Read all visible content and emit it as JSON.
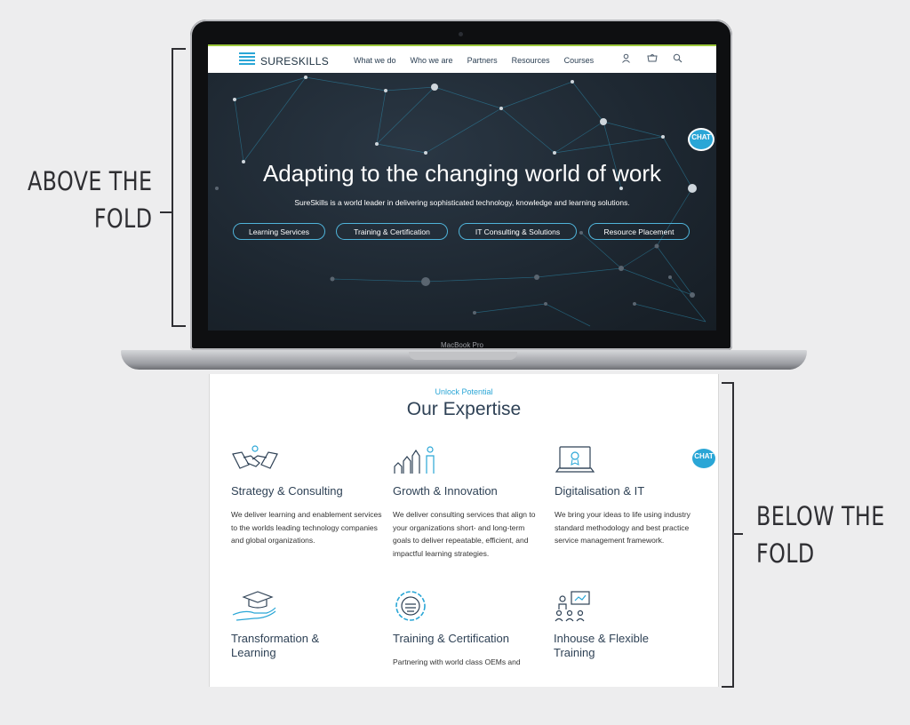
{
  "annotations": {
    "above": [
      "ABOVE THE",
      "FOLD"
    ],
    "below": [
      "BELOW THE",
      "FOLD"
    ]
  },
  "device": {
    "model": "MacBook Pro"
  },
  "nav": {
    "logo": "SURESKILLS",
    "links": [
      "What we do",
      "Who we are",
      "Partners",
      "Resources",
      "Courses"
    ],
    "icons": [
      "user-icon",
      "cart-icon",
      "search-icon"
    ]
  },
  "hero": {
    "title": "Adapting to the changing world of work",
    "subtitle": "SureSkills is a world leader in delivering sophisticated technology, knowledge and learning solutions.",
    "buttons": [
      "Learning Services",
      "Training & Certification",
      "IT Consulting & Solutions",
      "Resource Placement"
    ]
  },
  "chat": {
    "label": "CHAT"
  },
  "expertise": {
    "kicker": "Unlock Potential",
    "title": "Our Expertise",
    "cards": [
      {
        "icon": "handshake-icon",
        "title": "Strategy & Consulting",
        "body": "We deliver learning and enablement services to the worlds leading technology companies and global organizations."
      },
      {
        "icon": "growth-chart-icon",
        "title": "Growth & Innovation",
        "body": "We deliver consulting services that align to your organizations short- and long-term goals to deliver repeatable, efficient, and impactful learning strategies."
      },
      {
        "icon": "laptop-badge-icon",
        "title": "Digitalisation & IT",
        "body": "We bring your ideas to life using industry standard methodology and best practice service management framework."
      },
      {
        "icon": "graduation-hand-icon",
        "title": "Transformation & Learning",
        "body": ""
      },
      {
        "icon": "certification-icon",
        "title": "Training & Certification",
        "body": "Partnering with world class OEMs and"
      },
      {
        "icon": "classroom-icon",
        "title": "Inhouse & Flexible Training",
        "body": ""
      }
    ]
  },
  "colors": {
    "accent": "#2aa6d6",
    "nav_border": "#9cc83b",
    "heading": "#2f4256",
    "hero_bg": "#1f2933"
  }
}
